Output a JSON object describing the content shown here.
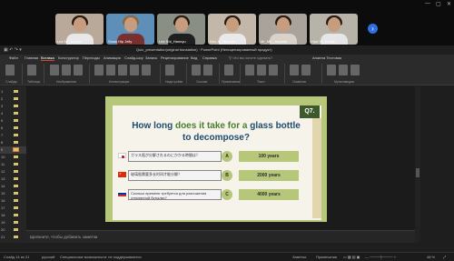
{
  "video_call": {
    "participants": [
      {
        "name": "Lee Mr_Marian"
      },
      {
        "name": "Snow Hip Jelly"
      },
      {
        "name": "Lee Shi_Hannyu"
      },
      {
        "name": "Kim Jo_Bernitm"
      },
      {
        "name": "Mr_Mir_Jahyalla"
      },
      {
        "name": "Hya Yu_Kindle"
      }
    ],
    "next_icon": "chevron-right-icon"
  },
  "window": {
    "title": "Quiz_presentation(original translation) · PowerPoint (Нелицензированный продукт)"
  },
  "ribbon_tabs": [
    "Файл",
    "Главная",
    "Вставка",
    "Конструктор",
    "Переходы",
    "Анимация",
    "Слайд-шоу",
    "Запись",
    "Рецензирование",
    "Вид",
    "Справка"
  ],
  "active_tab": "Вставка",
  "search_placeholder": "Что вы хотите сделать?",
  "share_label": "Анжела Тестовая",
  "ribbon_groups": [
    "Слайды",
    "Таблицы",
    "Изображения",
    "Иллюстрации",
    "Надстройки",
    "Ссылки",
    "Примечания",
    "Текст",
    "Символы",
    "Мультимедиа"
  ],
  "slide_numbers": [
    "1",
    "2",
    "3",
    "4",
    "5",
    "6",
    "7",
    "8",
    "9",
    "10",
    "11",
    "12",
    "13",
    "14",
    "15",
    "16",
    "17",
    "18",
    "19",
    "20",
    "21"
  ],
  "active_slide_index": 8,
  "slide": {
    "badge": "Q7.",
    "title_part1": "How long ",
    "title_highlight1": "does it take for a ",
    "title_part2": "glass bottle",
    "title_line2": "to decompose?",
    "questions": [
      {
        "flag": "japan",
        "text": "ガラス瓶が分解されるのにかかる時間は？",
        "letter": "A",
        "answer": "100 years"
      },
      {
        "flag": "china",
        "text": "玻璃瓶需要多长时间才能分解？",
        "letter": "B",
        "answer": "2000 years"
      },
      {
        "flag": "russia",
        "text": "Сколько времени требуется для разложения стеклянной бутылки?",
        "letter": "C",
        "answer": "4000 years"
      }
    ],
    "colors": {
      "frame": "#b7c779",
      "title": "#1f4c6e",
      "highlight": "#4b7d2f"
    }
  },
  "notes_placeholder": "Щелкните, чтобы добавить заметки",
  "status": {
    "slide": "Слайд 14 из 21",
    "language": "русский",
    "accessibility": "Специальные возможности: не поддерживается",
    "notes": "Заметки",
    "comments": "Примечания",
    "zoom": "48 %"
  }
}
